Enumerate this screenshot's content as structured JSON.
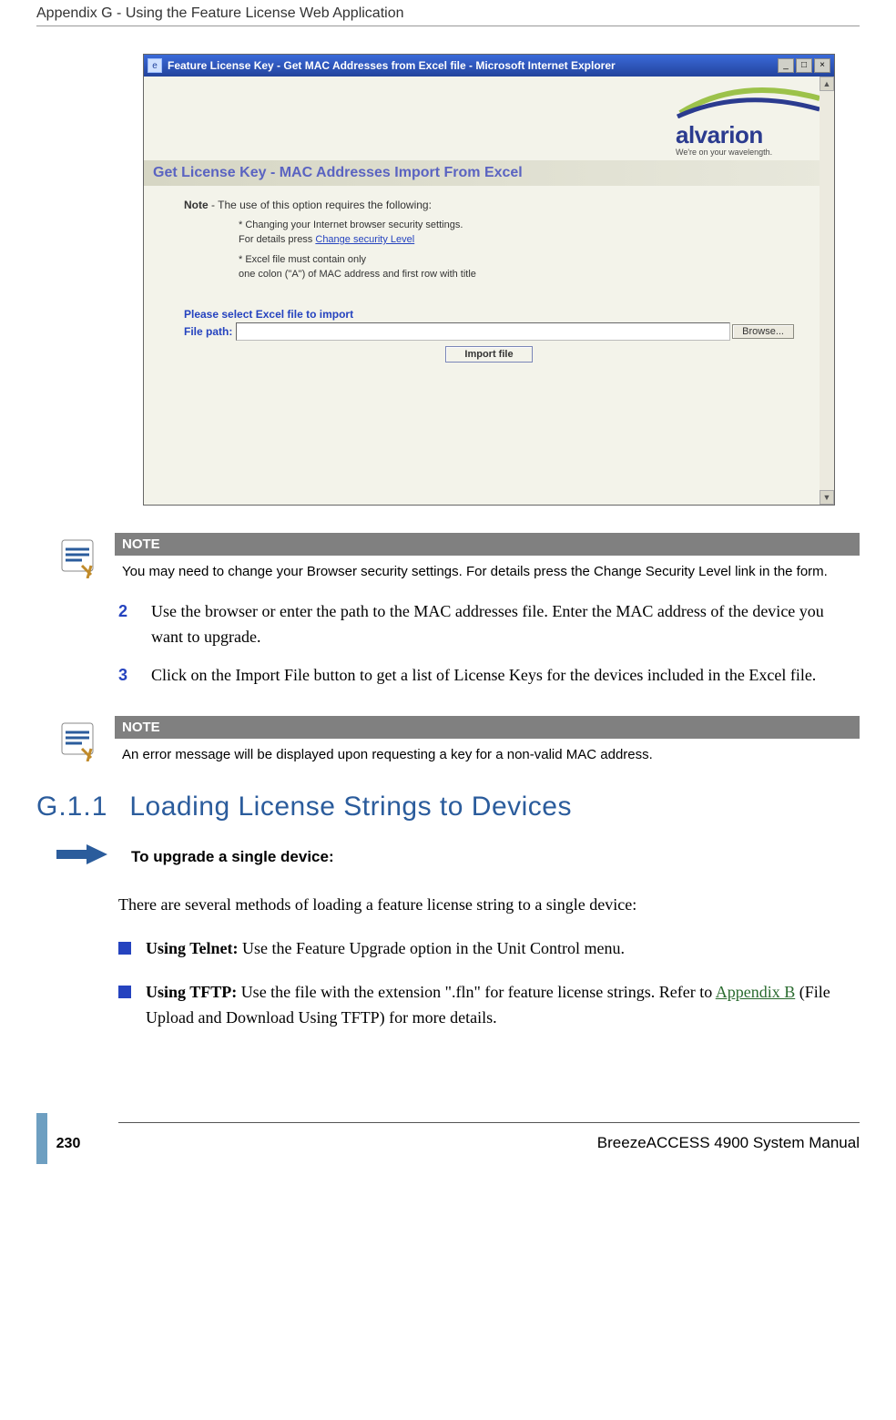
{
  "header": {
    "running": "Appendix G - Using the Feature License Web Application"
  },
  "screenshot": {
    "titlebar": "Feature License Key - Get MAC Addresses from Excel file - Microsoft Internet Explorer",
    "logo_name": "alvarion",
    "logo_tag": "We're on your wavelength.",
    "dialog_title": "Get License Key - MAC Addresses Import From Excel",
    "note_label": "Note",
    "note_text": " - The use of this option requires the following:",
    "bullet1a": "* Changing your Internet browser security settings.",
    "bullet1b": "For details press ",
    "bullet1b_link": "Change security Level",
    "bullet2a": "* Excel file must contain only",
    "bullet2b": "one colon (\"A\") of MAC address and first row with title",
    "select_prompt": "Please select Excel file to import",
    "file_label": "File path:",
    "browse": "Browse...",
    "import": "Import file"
  },
  "note1": {
    "header": "NOTE",
    "body": "You may need to change your Browser security settings. For details press the Change Security Level link in the form."
  },
  "steps": {
    "s2_num": "2",
    "s2": "Use the browser or enter the path to the MAC addresses file. Enter the MAC address of the device you want to upgrade.",
    "s3_num": "3",
    "s3": "Click on the Import File button to get a list of License Keys for the devices included in the Excel file."
  },
  "note2": {
    "header": "NOTE",
    "body": "An error message will be displayed upon requesting a key for a non-valid MAC address."
  },
  "section": {
    "num": "G.1.1",
    "title": "Loading License Strings to Devices"
  },
  "procedure": {
    "label": "To upgrade a single device:"
  },
  "para1": "There are several methods of loading a feature license string to a single device:",
  "bullets": {
    "b1_lead": "Using Telnet:",
    "b1_rest": " Use the Feature Upgrade option in the Unit Control menu.",
    "b2_lead": "Using TFTP:",
    "b2_rest1": "  Use the file with the extension \".fln\" for feature license strings. Refer to ",
    "b2_link": "Appendix B",
    "b2_rest2": " (File Upload and Download Using TFTP) for more details."
  },
  "footer": {
    "page": "230",
    "manual": "BreezeACCESS 4900 System Manual"
  }
}
